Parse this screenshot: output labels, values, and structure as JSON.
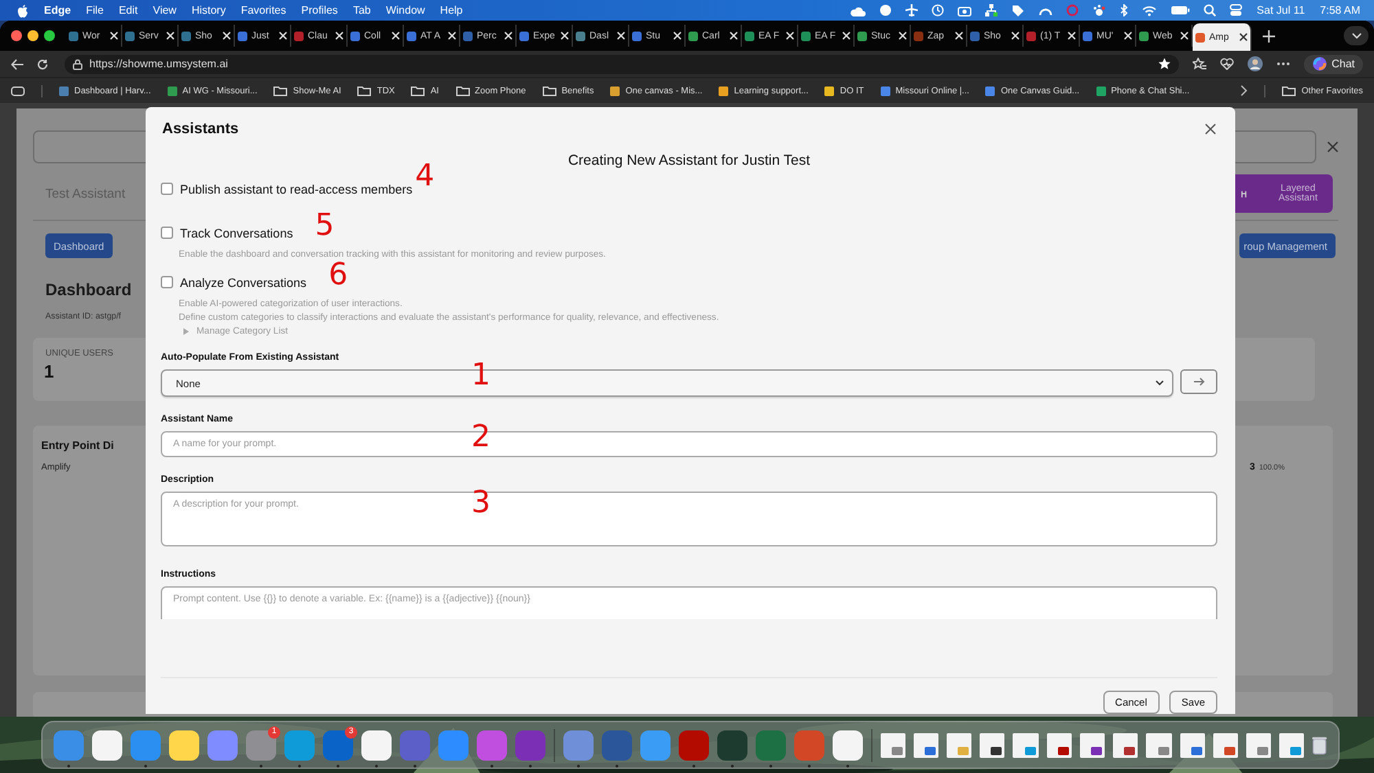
{
  "menu_bar": {
    "app": "Edge",
    "items": [
      "File",
      "Edit",
      "View",
      "History",
      "Favorites",
      "Profiles",
      "Tab",
      "Window",
      "Help"
    ],
    "date": "Sat Jul 11",
    "time": "7:58 AM"
  },
  "browser": {
    "tabs": [
      {
        "title": "Wor",
        "color": "#2f6f8f",
        "selected": false
      },
      {
        "title": "Serv",
        "color": "#2f6f8f",
        "selected": false
      },
      {
        "title": "Sho",
        "color": "#2f6f8f",
        "selected": false
      },
      {
        "title": "Just",
        "color": "#3a6fd8",
        "selected": false
      },
      {
        "title": "Clau",
        "color": "#b3202a",
        "selected": false
      },
      {
        "title": "Coll",
        "color": "#3a6fd8",
        "selected": false
      },
      {
        "title": "AT A",
        "color": "#3a6fd8",
        "selected": false
      },
      {
        "title": "Perc",
        "color": "#2e5fa8",
        "selected": false
      },
      {
        "title": "Expe",
        "color": "#3a6fd8",
        "selected": false
      },
      {
        "title": "Dasl",
        "color": "#4a7f8f",
        "selected": false
      },
      {
        "title": "Stu",
        "color": "#3a6fd8",
        "selected": false
      },
      {
        "title": "Carl",
        "color": "#2e9b4f",
        "selected": false
      },
      {
        "title": "EA F",
        "color": "#1f8f5a",
        "selected": false
      },
      {
        "title": "EA F",
        "color": "#1f8f5a",
        "selected": false
      },
      {
        "title": "Stuc",
        "color": "#2e9b4f",
        "selected": false
      },
      {
        "title": "Zap",
        "color": "#8a2e12",
        "selected": false
      },
      {
        "title": "Sho",
        "color": "#2e5fa8",
        "selected": false
      },
      {
        "title": "(1) T",
        "color": "#b3202a",
        "selected": false
      },
      {
        "title": "MU'",
        "color": "#3a6fd8",
        "selected": false
      },
      {
        "title": "Web",
        "color": "#2e9b4f",
        "selected": false
      },
      {
        "title": "Amp",
        "color": "#e0592a",
        "selected": true
      }
    ],
    "url": "https://showme.umsystem.ai",
    "chat_button": "Chat",
    "bookmarks": [
      {
        "kind": "site",
        "label": "Dashboard | Harv...",
        "color": "#4a7fb0"
      },
      {
        "kind": "site",
        "label": "AI WG - Missouri...",
        "color": "#2e9b4f"
      },
      {
        "kind": "folder",
        "label": "Show-Me AI"
      },
      {
        "kind": "folder",
        "label": "TDX"
      },
      {
        "kind": "folder",
        "label": "AI"
      },
      {
        "kind": "folder",
        "label": "Zoom Phone"
      },
      {
        "kind": "folder",
        "label": "Benefits"
      },
      {
        "kind": "site",
        "label": "One canvas - Mis...",
        "color": "#d9a030"
      },
      {
        "kind": "site",
        "label": "Learning support...",
        "color": "#e8a020"
      },
      {
        "kind": "site",
        "label": "DO IT",
        "color": "#e8b820"
      },
      {
        "kind": "site",
        "label": "Missouri Online |...",
        "color": "#4a86e8"
      },
      {
        "kind": "site",
        "label": "One Canvas Guid...",
        "color": "#4a86e8"
      },
      {
        "kind": "site",
        "label": "Phone & Chat Shi...",
        "color": "#1fa463"
      }
    ],
    "other_favorites": "Other Favorites"
  },
  "background_app": {
    "tab": "Test Assistant",
    "layered_button": "Layered Assistant",
    "dashboard_button": "Dashboard",
    "group_button": "roup Management",
    "heading": "Dashboard",
    "assistant_id": "Assistant ID: astgp/f",
    "stat_label": "UNIQUE USERS",
    "stat_value": "1",
    "entry_title": "Entry Point Di",
    "entry_row": "Amplify",
    "entry_count": "3",
    "entry_percent": "100.0%"
  },
  "modal": {
    "header": "Assistants",
    "title": "Creating New Assistant for Justin Test",
    "options": [
      {
        "label": "Publish assistant to read-access members",
        "checked": false,
        "annotation": "4"
      },
      {
        "label": "Track Conversations",
        "checked": false,
        "annotation": "5",
        "descriptions": [
          "Enable the dashboard and conversation tracking with this assistant for monitoring and review purposes."
        ]
      },
      {
        "label": "Analyze Conversations",
        "checked": false,
        "annotation": "6",
        "descriptions": [
          "Enable AI-powered categorization of user interactions.",
          "Define custom categories to classify interactions and evaluate the assistant's performance for quality, relevance, and effectiveness."
        ],
        "disclosure": {
          "label": "Manage Category List",
          "expanded": false
        }
      }
    ],
    "fields": [
      {
        "kind": "select",
        "label": "Auto-Populate From Existing Assistant",
        "value": "None",
        "annotation": "1"
      },
      {
        "kind": "input",
        "label": "Assistant Name",
        "placeholder": "A name for your prompt.",
        "annotation": "2"
      },
      {
        "kind": "textarea",
        "label": "Description",
        "placeholder": "A description for your prompt.",
        "annotation": "3"
      },
      {
        "kind": "textarea-cut",
        "label": "Instructions",
        "placeholder": "Prompt content. Use {{}} to denote a variable. Ex: {{name}} is a {{adjective}} {{noun}}"
      }
    ],
    "buttons": [
      "Cancel",
      "Save"
    ]
  },
  "dock": {
    "apps": [
      {
        "color": "#3a8ee6",
        "running": true
      },
      {
        "color": "#f4f4f4",
        "running": false
      },
      {
        "color": "#2a8ff0",
        "running": true
      },
      {
        "color": "#ffd54a",
        "running": false
      },
      {
        "color": "#7f8cff",
        "running": false
      },
      {
        "color": "#8e8e93",
        "running": true,
        "badge": "1"
      },
      {
        "color": "#0f9bd7",
        "running": true
      },
      {
        "color": "#0a64c8",
        "running": true,
        "badge": "3"
      },
      {
        "color": "#f4f4f4",
        "running": true
      },
      {
        "color": "#5b5fc7",
        "running": true
      },
      {
        "color": "#2d8cff",
        "running": false
      },
      {
        "color": "#c04fe0",
        "running": true
      },
      {
        "color": "#7b2fb5",
        "running": true
      },
      {
        "color": "#6f8fd8",
        "running": true
      },
      {
        "color": "#2b579a",
        "running": true
      },
      {
        "color": "#3b9cf5",
        "running": false
      },
      {
        "color": "#b30b00",
        "running": true
      },
      {
        "color": "#1d3b2f",
        "running": true
      },
      {
        "color": "#1d7044",
        "running": true
      },
      {
        "color": "#d24726",
        "running": true
      },
      {
        "color": "#f4f4f4",
        "running": true
      }
    ],
    "windows": [
      {
        "color": "#888888"
      },
      {
        "color": "#2d6fd8"
      },
      {
        "color": "#e0b040"
      },
      {
        "color": "#333333"
      },
      {
        "color": "#0f9bd7"
      },
      {
        "color": "#b30b00"
      },
      {
        "color": "#7b2fb5"
      },
      {
        "color": "#b33030"
      },
      {
        "color": "#888888"
      },
      {
        "color": "#2d6fd8"
      },
      {
        "color": "#d24726"
      },
      {
        "color": "#888888"
      },
      {
        "color": "#0f9bd7"
      }
    ]
  }
}
